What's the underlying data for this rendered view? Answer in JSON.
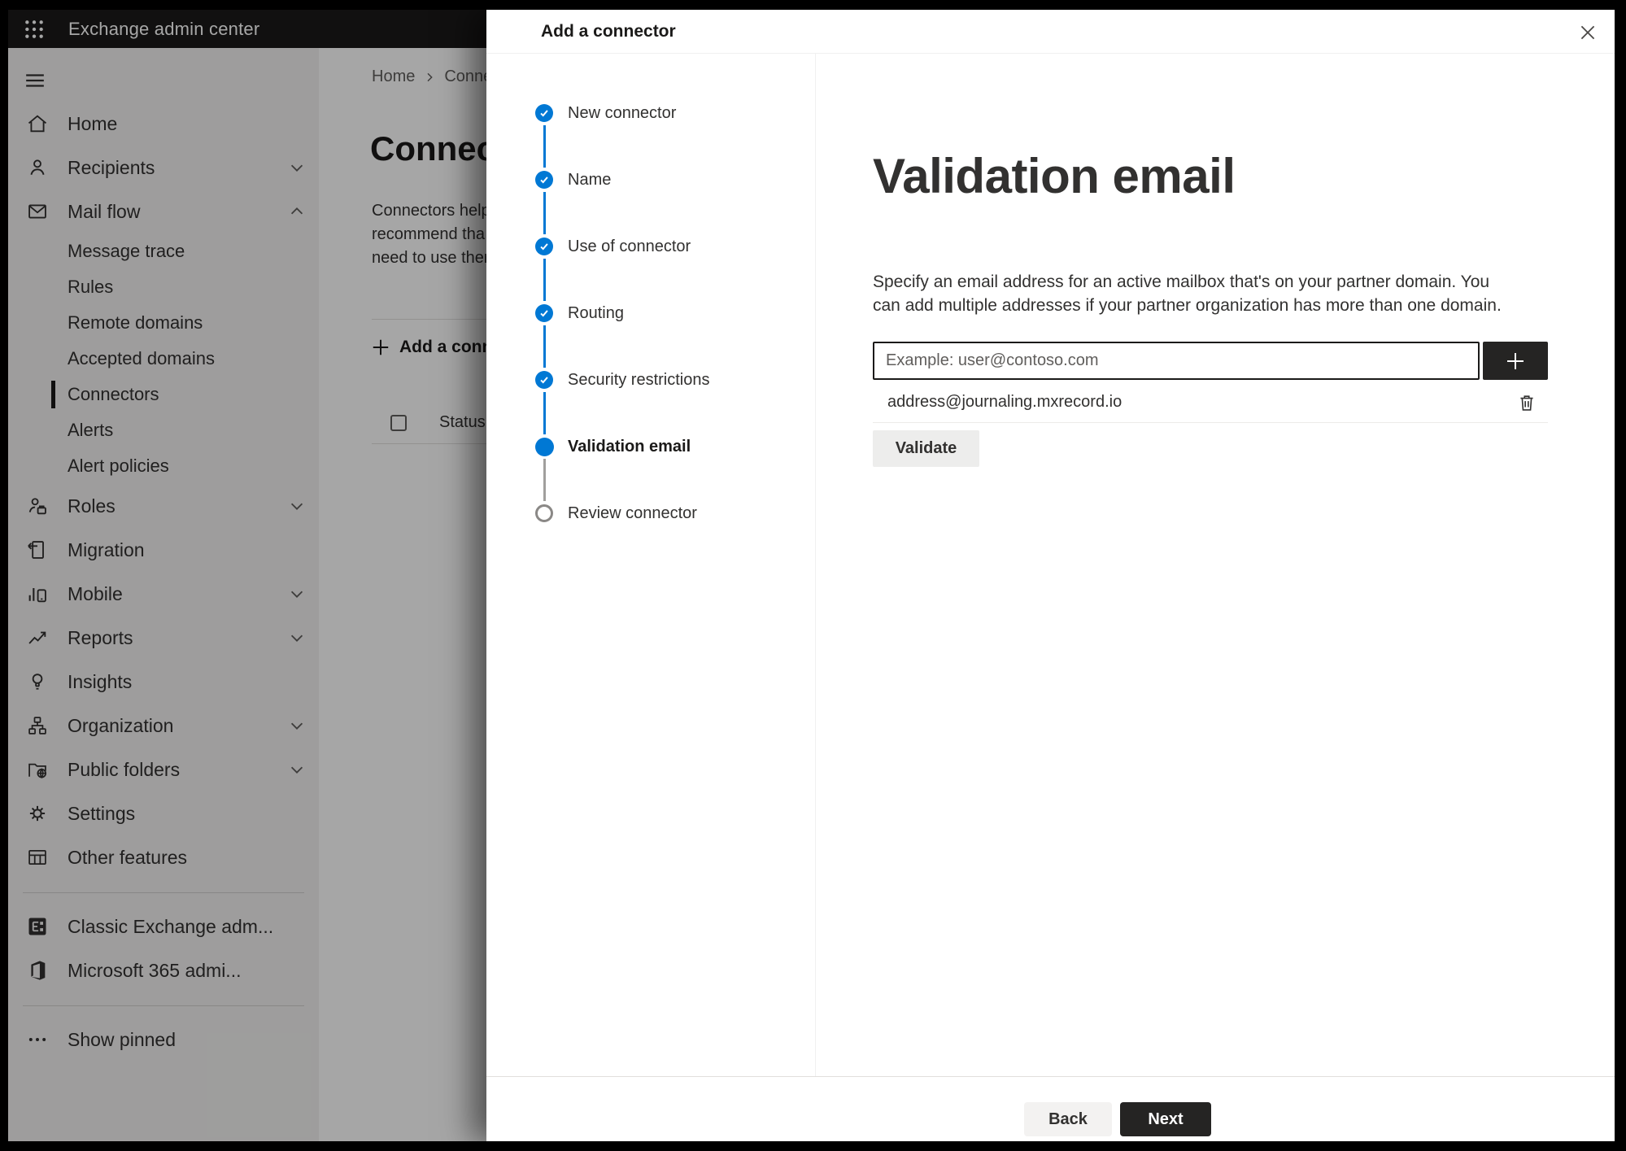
{
  "topbar": {
    "title": "Exchange admin center"
  },
  "sidebar": {
    "items": [
      {
        "label": "Home",
        "icon": "home-icon"
      },
      {
        "label": "Recipients",
        "icon": "recipients-icon",
        "chevron": "down"
      },
      {
        "label": "Mail flow",
        "icon": "mail-flow-icon",
        "chevron": "up",
        "expanded": true
      },
      {
        "label": "Message trace",
        "sub": true
      },
      {
        "label": "Rules",
        "sub": true
      },
      {
        "label": "Remote domains",
        "sub": true
      },
      {
        "label": "Accepted domains",
        "sub": true
      },
      {
        "label": "Connectors",
        "sub": true,
        "selected": true
      },
      {
        "label": "Alerts",
        "sub": true
      },
      {
        "label": "Alert policies",
        "sub": true
      },
      {
        "label": "Roles",
        "icon": "roles-icon",
        "chevron": "down"
      },
      {
        "label": "Migration",
        "icon": "migration-icon"
      },
      {
        "label": "Mobile",
        "icon": "mobile-icon",
        "chevron": "down"
      },
      {
        "label": "Reports",
        "icon": "reports-icon",
        "chevron": "down"
      },
      {
        "label": "Insights",
        "icon": "insights-icon"
      },
      {
        "label": "Organization",
        "icon": "organization-icon",
        "chevron": "down"
      },
      {
        "label": "Public folders",
        "icon": "public-folders-icon",
        "chevron": "down"
      },
      {
        "label": "Settings",
        "icon": "settings-icon"
      },
      {
        "label": "Other features",
        "icon": "other-features-icon"
      },
      {
        "label": "Classic Exchange adm...",
        "icon": "classic-exchange-icon"
      },
      {
        "label": "Microsoft 365 admi...",
        "icon": "microsoft-365-icon"
      },
      {
        "label": "Show pinned",
        "icon": "more-icon"
      }
    ]
  },
  "page": {
    "breadcrumb": {
      "home": "Home",
      "current": "Conne"
    },
    "title": "Connec",
    "description_lines": [
      "Connectors help",
      "recommend tha",
      "need to use ther"
    ],
    "add_connector_label": "Add a conn",
    "table": {
      "status_header": "Status"
    }
  },
  "panel": {
    "title": "Add a connector",
    "steps": [
      {
        "label": "New connector",
        "state": "completed"
      },
      {
        "label": "Name",
        "state": "completed"
      },
      {
        "label": "Use of connector",
        "state": "completed"
      },
      {
        "label": "Routing",
        "state": "completed"
      },
      {
        "label": "Security restrictions",
        "state": "completed"
      },
      {
        "label": "Validation email",
        "state": "current"
      },
      {
        "label": "Review connector",
        "state": "upcoming"
      }
    ],
    "content": {
      "heading": "Validation email",
      "description": "Specify an email address for an active mailbox that's on your partner domain. You can add multiple addresses if your partner organization has more than one domain.",
      "email_placeholder": "Example: user@contoso.com",
      "addresses": [
        {
          "email": "address@journaling.mxrecord.io"
        }
      ],
      "validate_label": "Validate"
    },
    "footer": {
      "back_label": "Back",
      "next_label": "Next"
    }
  },
  "colors": {
    "accent": "#0078d4",
    "topbar_bg": "#1b1a19",
    "dark_button_bg": "#252423",
    "sidebar_bg": "#f3f2f1"
  }
}
